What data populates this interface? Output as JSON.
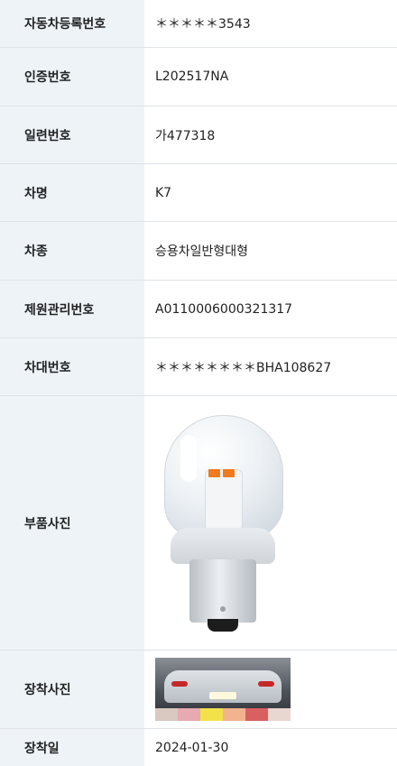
{
  "rows": [
    {
      "label": "자동차등록번호",
      "value": "＊＊＊＊＊3543"
    },
    {
      "label": "인증번호",
      "value": "L202517NA"
    },
    {
      "label": "일련번호",
      "value": "가477318"
    },
    {
      "label": "차명",
      "value": "K7"
    },
    {
      "label": "차종",
      "value": "승용차일반형대형"
    },
    {
      "label": "제원관리번호",
      "value": "A0110006000321317"
    },
    {
      "label": "차대번호",
      "value": "＊＊＊＊＊＊＊＊BHA108627"
    },
    {
      "label": "부품사진",
      "image": "led-bulb-photo"
    },
    {
      "label": "장착사진",
      "image": "installed-tail-light-photo"
    },
    {
      "label": "장착일",
      "value": "2024-01-30"
    }
  ],
  "colors": {
    "label_bg": "#eef3f8",
    "divider": "#dfe3e8",
    "led": "#f07a1d"
  }
}
